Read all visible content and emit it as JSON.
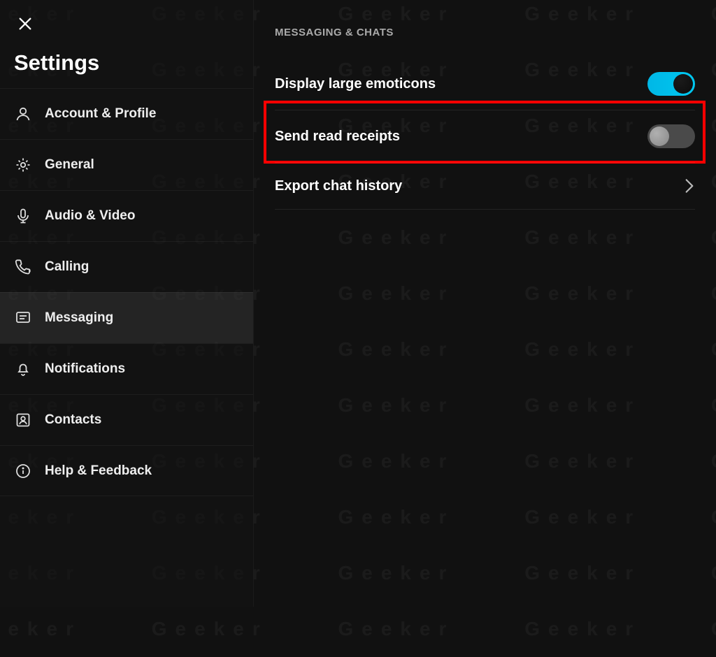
{
  "title": "Settings",
  "sidebar": {
    "items": [
      {
        "label": "Account & Profile",
        "icon": "person-icon",
        "active": false
      },
      {
        "label": "General",
        "icon": "gear-icon",
        "active": false
      },
      {
        "label": "Audio & Video",
        "icon": "mic-icon",
        "active": false
      },
      {
        "label": "Calling",
        "icon": "phone-icon",
        "active": false
      },
      {
        "label": "Messaging",
        "icon": "chat-icon",
        "active": true
      },
      {
        "label": "Notifications",
        "icon": "bell-icon",
        "active": false
      },
      {
        "label": "Contacts",
        "icon": "contacts-icon",
        "active": false
      },
      {
        "label": "Help & Feedback",
        "icon": "info-icon",
        "active": false
      }
    ]
  },
  "main": {
    "section_heading": "MESSAGING & CHATS",
    "rows": {
      "emoticons": {
        "label": "Display large emoticons",
        "toggle": "on"
      },
      "read_receipts": {
        "label": "Send read receipts",
        "toggle": "off",
        "highlighted": true
      },
      "export": {
        "label": "Export chat history",
        "type": "link"
      }
    }
  },
  "colors": {
    "toggle_on": "#00b7e6",
    "highlight_border": "#ff0000"
  }
}
